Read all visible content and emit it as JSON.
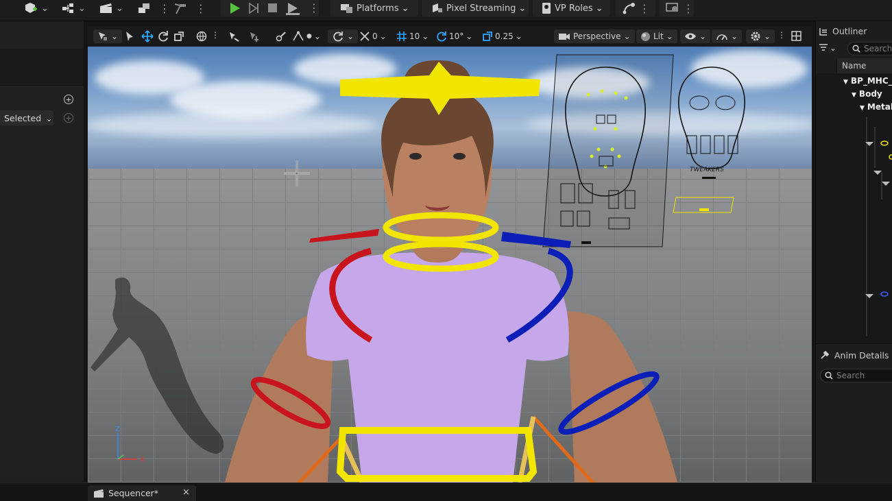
{
  "top_toolbar": {
    "platforms_label": "Platforms",
    "pixel_streaming_label": "Pixel Streaming",
    "vp_roles_label": "VP Roles"
  },
  "left_panel": {
    "filter_label": "Selected"
  },
  "viewport_toolbar": {
    "translate_snap": "0",
    "grid_snap": "10",
    "rotation_snap": "10°",
    "scale_snap": "0.25",
    "view_mode": "Perspective",
    "lighting_mode": "Lit"
  },
  "viewport": {
    "control_board_label": "TWEAKERS",
    "gizmo_axes": {
      "z": "Z",
      "x": "X"
    }
  },
  "outliner": {
    "title": "Outliner",
    "search_placeholder": "Search",
    "column_header": "Name",
    "items": [
      {
        "label": "BP_MHC_"
      },
      {
        "label": "Body"
      },
      {
        "label": "Metah"
      }
    ]
  },
  "anim_details": {
    "title": "Anim Details",
    "search_placeholder": "Search"
  },
  "bottom": {
    "sequencer_tab_label": "Sequencer*"
  },
  "colors": {
    "accent_play": "#58c13e",
    "accent_cyan": "#2aa6ff",
    "gizmo_yellow": "#f2e600",
    "gizmo_red": "#c8141c",
    "gizmo_blue": "#0b1fb8",
    "panel_bg": "#1d1d1d"
  }
}
